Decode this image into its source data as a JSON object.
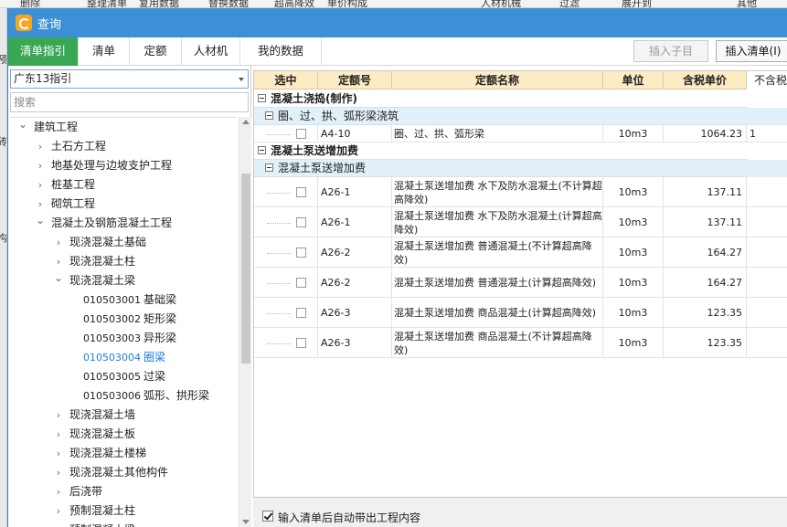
{
  "background_app": {
    "toolbar_items": [
      "删除",
      "整理清单",
      "复用数据",
      "替换数据",
      "超高降效",
      "单价构成",
      "人材机械",
      "过滤",
      "展开到",
      "其他"
    ],
    "left_fragments": [
      "预",
      "砖",
      "构"
    ]
  },
  "dialog": {
    "title": "查询",
    "tabs": [
      "清单指引",
      "清单",
      "定额",
      "人材机",
      "我的数据"
    ],
    "active_tab": "清单指引",
    "insert_sub_label": "插入子目",
    "insert_list_label": "插入清单(I)"
  },
  "left_panel": {
    "selected_library": "广东13指引",
    "search_placeholder": "搜索",
    "tree": [
      {
        "label": "建筑工程",
        "level": 0,
        "expanded": true
      },
      {
        "label": "土石方工程",
        "level": 1,
        "expanded": false
      },
      {
        "label": "地基处理与边坡支护工程",
        "level": 1,
        "expanded": false
      },
      {
        "label": "桩基工程",
        "level": 1,
        "expanded": false
      },
      {
        "label": "砌筑工程",
        "level": 1,
        "expanded": false
      },
      {
        "label": "混凝土及钢筋混凝土工程",
        "level": 1,
        "expanded": true
      },
      {
        "label": "现浇混凝土基础",
        "level": 2,
        "expanded": false
      },
      {
        "label": "现浇混凝土柱",
        "level": 2,
        "expanded": false
      },
      {
        "label": "现浇混凝土梁",
        "level": 2,
        "expanded": true
      },
      {
        "code": "010503001",
        "label": "基础梁",
        "level": 3
      },
      {
        "code": "010503002",
        "label": "矩形梁",
        "level": 3
      },
      {
        "code": "010503003",
        "label": "异形梁",
        "level": 3
      },
      {
        "code": "010503004",
        "label": "圈梁",
        "level": 3,
        "selected": true
      },
      {
        "code": "010503005",
        "label": "过梁",
        "level": 3
      },
      {
        "code": "010503006",
        "label": "弧形、拱形梁",
        "level": 3
      },
      {
        "label": "现浇混凝土墙",
        "level": 2,
        "expanded": false
      },
      {
        "label": "现浇混凝土板",
        "level": 2,
        "expanded": false
      },
      {
        "label": "现浇混凝土楼梯",
        "level": 2,
        "expanded": false
      },
      {
        "label": "现浇混凝土其他构件",
        "level": 2,
        "expanded": false
      },
      {
        "label": "后浇带",
        "level": 2,
        "expanded": false
      },
      {
        "label": "预制混凝土柱",
        "level": 2,
        "expanded": false
      },
      {
        "label": "预制混凝土梁",
        "level": 2,
        "expanded": false
      }
    ]
  },
  "grid": {
    "columns": [
      "选中",
      "定额号",
      "定额名称",
      "单位",
      "含税单价",
      "不含税"
    ],
    "groups": [
      {
        "title": "混凝土浇捣(制作)",
        "subgroups": [
          {
            "title": "圈、过、拱、弧形梁浇筑",
            "rows": [
              {
                "code": "A4-10",
                "name": "圈、过、拱、弧形梁",
                "unit": "10m3",
                "price": "1064.23",
                "extra": "1"
              }
            ]
          }
        ]
      },
      {
        "title": "混凝土泵送增加费",
        "subgroups": [
          {
            "title": "混凝土泵送增加费",
            "rows": [
              {
                "code": "A26-1",
                "name": "混凝土泵送增加费 水下及防水混凝土(不计算超高降效)",
                "unit": "10m3",
                "price": "137.11",
                "extra": ""
              },
              {
                "code": "A26-1",
                "name": "混凝土泵送增加费 水下及防水混凝土(计算超高降效)",
                "unit": "10m3",
                "price": "137.11",
                "extra": ""
              },
              {
                "code": "A26-2",
                "name": "混凝土泵送增加费 普通混凝土(不计算超高降效)",
                "unit": "10m3",
                "price": "164.27",
                "extra": ""
              },
              {
                "code": "A26-2",
                "name": "混凝土泵送增加费 普通混凝土(计算超高降效)",
                "unit": "10m3",
                "price": "164.27",
                "extra": ""
              },
              {
                "code": "A26-3",
                "name": "混凝土泵送增加费 商品混凝土(计算超高降效)",
                "unit": "10m3",
                "price": "123.35",
                "extra": ""
              },
              {
                "code": "A26-3",
                "name": "混凝土泵送增加费 商品混凝土(不计算超高降效)",
                "unit": "10m3",
                "price": "123.35",
                "extra": ""
              }
            ]
          }
        ]
      }
    ]
  },
  "footer": {
    "auto_bring_label": "输入清单后自动带出工程内容",
    "auto_bring_checked": true
  }
}
